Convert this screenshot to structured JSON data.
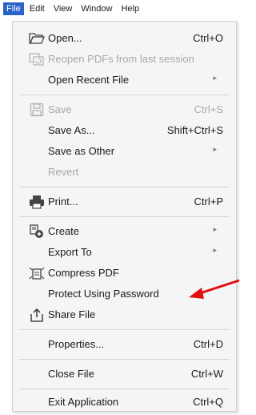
{
  "menubar": {
    "items": [
      "File",
      "Edit",
      "View",
      "Window",
      "Help"
    ]
  },
  "menu": {
    "open": {
      "label": "Open...",
      "shortcut": "Ctrl+O",
      "icon": "folder-open-icon"
    },
    "reopen": {
      "label": "Reopen PDFs from last session",
      "icon": "reopen-session-icon"
    },
    "open_recent": {
      "label": "Open Recent File",
      "arrow": "▸"
    },
    "save": {
      "label": "Save",
      "shortcut": "Ctrl+S",
      "icon": "save-disk-icon"
    },
    "save_as": {
      "label": "Save As...",
      "shortcut": "Shift+Ctrl+S"
    },
    "save_other": {
      "label": "Save as Other",
      "arrow": "▸"
    },
    "revert": {
      "label": "Revert"
    },
    "print": {
      "label": "Print...",
      "shortcut": "Ctrl+P",
      "icon": "printer-icon"
    },
    "create": {
      "label": "Create",
      "arrow": "▸",
      "icon": "create-pdf-icon"
    },
    "export": {
      "label": "Export To",
      "arrow": "▸"
    },
    "compress": {
      "label": "Compress PDF",
      "icon": "compress-icon"
    },
    "protect": {
      "label": "Protect Using Password"
    },
    "share": {
      "label": "Share File",
      "icon": "share-upload-icon"
    },
    "properties": {
      "label": "Properties...",
      "shortcut": "Ctrl+D"
    },
    "close": {
      "label": "Close File",
      "shortcut": "Ctrl+W"
    },
    "exit": {
      "label": "Exit Application",
      "shortcut": "Ctrl+Q"
    }
  },
  "colors": {
    "menu_bg": "#f5f5f5",
    "active_menu": "#2a63c8",
    "disabled_text": "#a8a8a8",
    "annotation_arrow": "#e01010"
  }
}
